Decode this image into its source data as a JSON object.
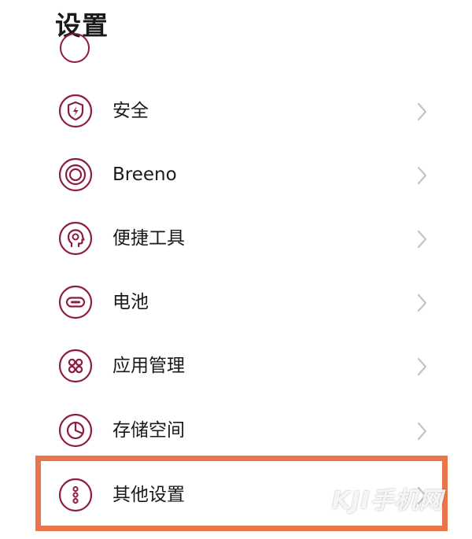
{
  "header": {
    "title": "设置"
  },
  "items": [
    {
      "label": "安全",
      "icon": "shield-bolt-icon"
    },
    {
      "label": "Breeno",
      "icon": "breeno-rings-icon"
    },
    {
      "label": "便捷工具",
      "icon": "head-gear-icon"
    },
    {
      "label": "电池",
      "icon": "battery-icon"
    },
    {
      "label": "应用管理",
      "icon": "app-grid-icon"
    },
    {
      "label": "存储空间",
      "icon": "storage-pie-icon"
    },
    {
      "label": "其他设置",
      "icon": "more-dots-icon"
    }
  ],
  "highlighted_item": "其他设置",
  "watermark": "KJI手机网",
  "colors": {
    "icon_accent": "#8e1b42",
    "highlight_border": "#e8764a",
    "chevron": "#c4c4c4"
  }
}
